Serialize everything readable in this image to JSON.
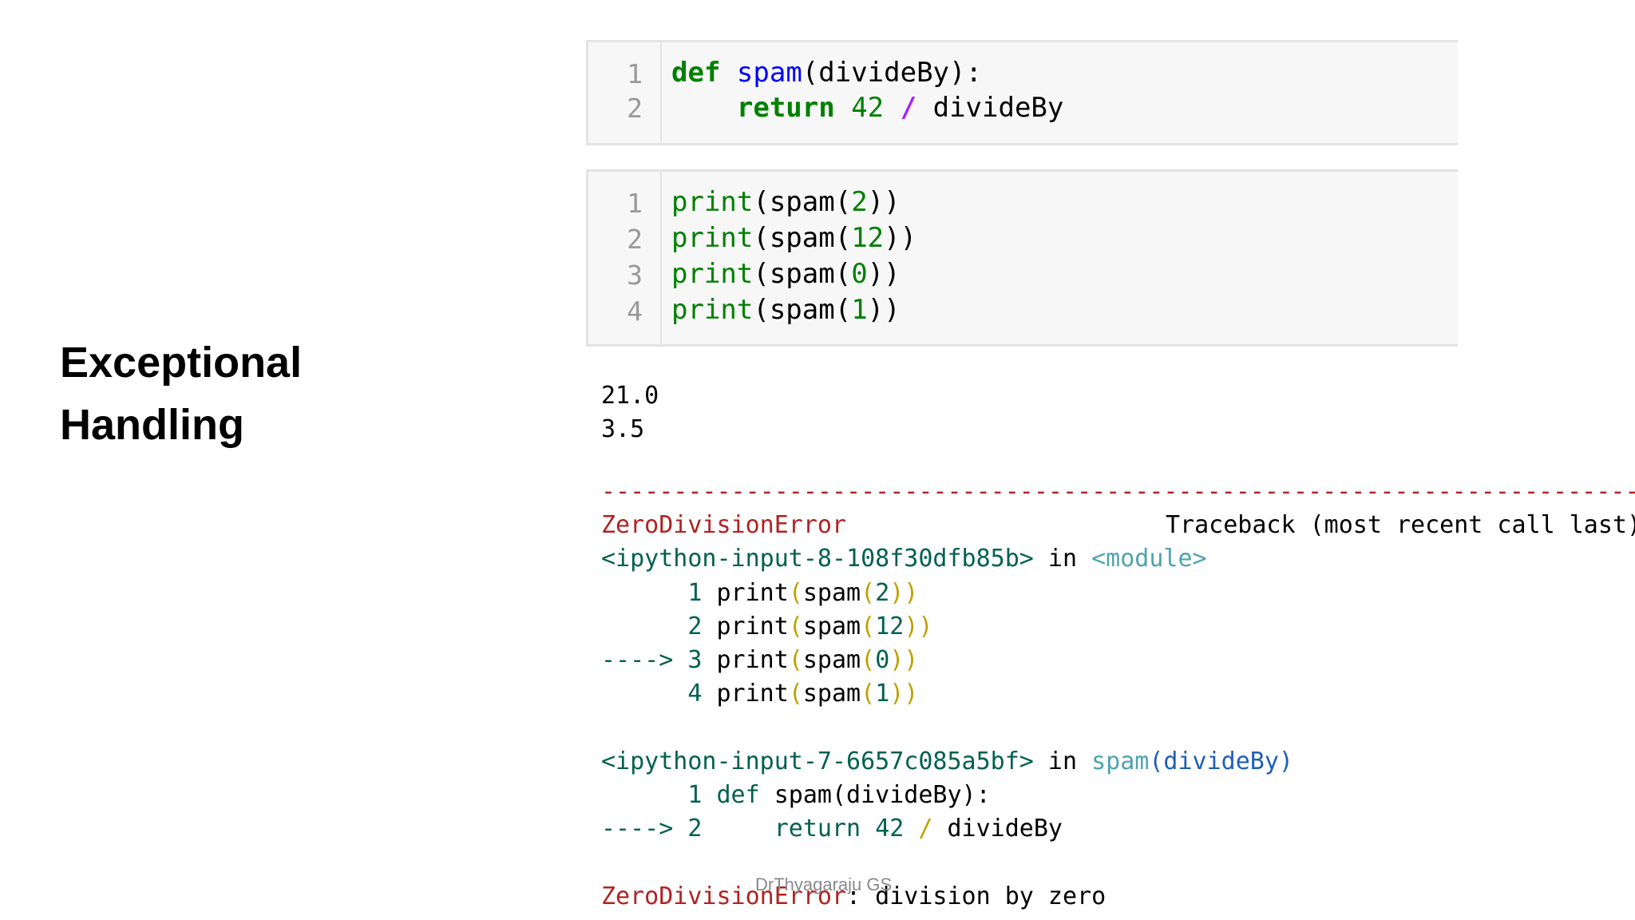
{
  "slide": {
    "title_line1": "Exceptional",
    "title_line2": "Handling"
  },
  "cell1": {
    "line_numbers": [
      "1",
      "2"
    ],
    "lines": [
      {
        "kw": "def",
        "fn": "spam",
        "rest": "(divideBy):"
      },
      {
        "kw": "return",
        "num": "42",
        "op": "/",
        "rest": "divideBy"
      }
    ]
  },
  "cell2": {
    "line_numbers": [
      "1",
      "2",
      "3",
      "4"
    ],
    "lines": [
      {
        "bi": "print",
        "pre": "(spam(",
        "num": "2",
        "post": "))"
      },
      {
        "bi": "print",
        "pre": "(spam(",
        "num": "12",
        "post": "))"
      },
      {
        "bi": "print",
        "pre": "(spam(",
        "num": "0",
        "post": "))"
      },
      {
        "bi": "print",
        "pre": "(spam(",
        "num": "1",
        "post": "))"
      }
    ]
  },
  "output": {
    "values": [
      "21.0",
      "3.5"
    ]
  },
  "traceback": {
    "separator": "---------------------------------------------------------------------------",
    "error_name": "ZeroDivisionError",
    "header_right": "Traceback (most recent call last)",
    "frame1": {
      "source": "<ipython-input-8-108f30dfb85b>",
      "in": "in",
      "context": "<module>",
      "lines": [
        {
          "marker": "",
          "num": "1",
          "code": "print",
          "arg": "2"
        },
        {
          "marker": "",
          "num": "2",
          "code": "print",
          "arg": "12"
        },
        {
          "marker": "---->",
          "num": "3",
          "code": "print",
          "arg": "0"
        },
        {
          "marker": "",
          "num": "4",
          "code": "print",
          "arg": "1"
        }
      ]
    },
    "frame2": {
      "source": "<ipython-input-7-6657c085a5bf>",
      "in": "in",
      "context_fn": "spam",
      "context_args": "(divideBy)",
      "line1_num": "1",
      "line1_kw": "def",
      "line1_rest": "spam(divideBy):",
      "line2_marker": "---->",
      "line2_num": "2",
      "line2_kw": "return",
      "line2_num_val": "42",
      "line2_op": "/",
      "line2_rest": "divideBy"
    },
    "final_error": "ZeroDivisionError",
    "final_message": ": division by zero"
  },
  "watermark": "DrThyagaraju GS"
}
